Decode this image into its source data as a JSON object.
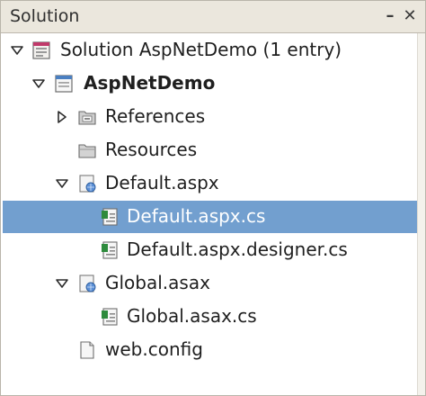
{
  "panel": {
    "title": "Solution",
    "minimize_label": "–",
    "close_label": "✕"
  },
  "tree": {
    "solution": {
      "label": "Solution AspNetDemo (1 entry)",
      "icon": "solution-icon",
      "expanded": true
    },
    "project": {
      "label": "AspNetDemo",
      "icon": "project-icon",
      "expanded": true
    },
    "references": {
      "label": "References",
      "icon": "references-folder-icon",
      "expanded": false
    },
    "resources": {
      "label": "Resources",
      "icon": "folder-icon"
    },
    "default_aspx": {
      "label": "Default.aspx",
      "icon": "web-form-icon",
      "expanded": true
    },
    "default_aspx_cs": {
      "label": "Default.aspx.cs",
      "icon": "csharp-file-icon",
      "selected": true
    },
    "default_aspx_designer_cs": {
      "label": "Default.aspx.designer.cs",
      "icon": "csharp-file-icon"
    },
    "global_asax": {
      "label": "Global.asax",
      "icon": "web-form-icon",
      "expanded": true
    },
    "global_asax_cs": {
      "label": "Global.asax.cs",
      "icon": "csharp-file-icon"
    },
    "web_config": {
      "label": "web.config",
      "icon": "file-icon"
    }
  },
  "colors": {
    "selection": "#729fcf",
    "titlebar": "#ebe7dd",
    "border": "#b9b5aa"
  }
}
